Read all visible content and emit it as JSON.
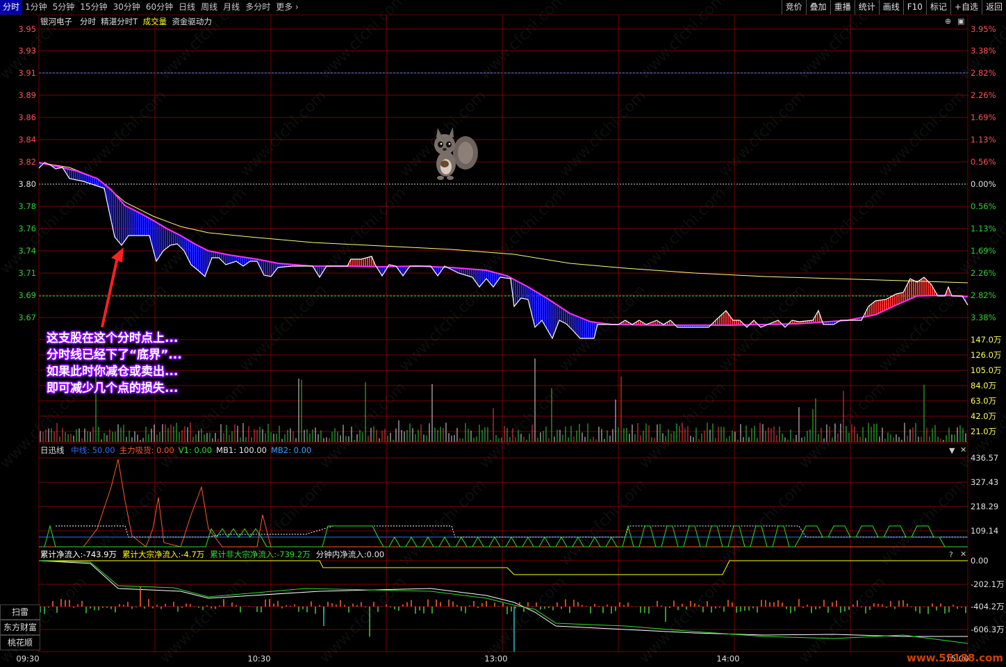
{
  "periods": [
    "分时",
    "1分钟",
    "5分钟",
    "15分钟",
    "30分钟",
    "60分钟",
    "日线",
    "周线",
    "月线",
    "多分时",
    "更多"
  ],
  "toolbar_right": [
    "竞价",
    "叠加",
    "重播",
    "统计",
    "画线",
    "F10",
    "标记",
    "+自选",
    "返回"
  ],
  "header": {
    "stock_name": "银河电子",
    "tabs": [
      "分时",
      "精湛分时T",
      "成交量",
      "资金驱动力"
    ]
  },
  "price_axis_left": [
    "3.95",
    "3.93",
    "3.91",
    "3.89",
    "3.86",
    "3.84",
    "3.82",
    "3.80",
    "3.78",
    "3.76",
    "3.74",
    "3.71",
    "3.69",
    "3.67"
  ],
  "price_axis_right": [
    "3.95%",
    "3.38%",
    "2.82%",
    "2.26%",
    "1.69%",
    "1.13%",
    "0.56%",
    "0.00%",
    "0.56%",
    "1.13%",
    "1.69%",
    "2.26%",
    "2.82%",
    "3.38%"
  ],
  "volume_axis": [
    "147.0万",
    "126.0万",
    "105.0万",
    "84.0万",
    "63.0万",
    "42.0万",
    "21.0万"
  ],
  "indicator": {
    "name": "日迅线",
    "params": [
      {
        "text": "中线: 50.00",
        "color": "#2f6bff"
      },
      {
        "text": "主力吸货: 0.00",
        "color": "#ff5a2a"
      },
      {
        "text": "V1: 0.00",
        "color": "#2fe02f"
      },
      {
        "text": "MB1: 100.00",
        "color": "#e8e8e8"
      },
      {
        "text": "MB2: 0.00",
        "color": "#3aa0ff"
      }
    ],
    "axis": [
      "436.57",
      "327.43",
      "218.29",
      "109.14"
    ]
  },
  "flow": {
    "params": [
      {
        "text": "累计净流入:-743.9万",
        "color": "#ffffff"
      },
      {
        "text": "累计大宗净流入:-4.7万",
        "color": "#ffff00"
      },
      {
        "text": "累计非大宗净流入:-739.2万",
        "color": "#2fe02f"
      },
      {
        "text": "分钟内净流入:0.00",
        "color": "#e8e8e8"
      }
    ],
    "axis": [
      "0.00",
      "-202.1万",
      "-404.2万",
      "-606.3万"
    ]
  },
  "time_axis": [
    "09:30",
    "10:30",
    "13:00",
    "14:00",
    "15:00"
  ],
  "side_buttons": [
    "扫雷",
    "东方财富",
    "桃花顺"
  ],
  "annotation": [
    "这支股在这个分时点上...",
    "分时线已经下了“底界”...",
    "如果此时你减仓或卖出...",
    "即可减少几个点的损失..."
  ],
  "watermark": "www.cfchi.com",
  "logo": "www.55188.com",
  "colors": {
    "up": "#ff3030",
    "down": "#2020ff",
    "avg": "#ff30ff",
    "ma": "#ffff80",
    "grid": "#7a0000"
  }
}
